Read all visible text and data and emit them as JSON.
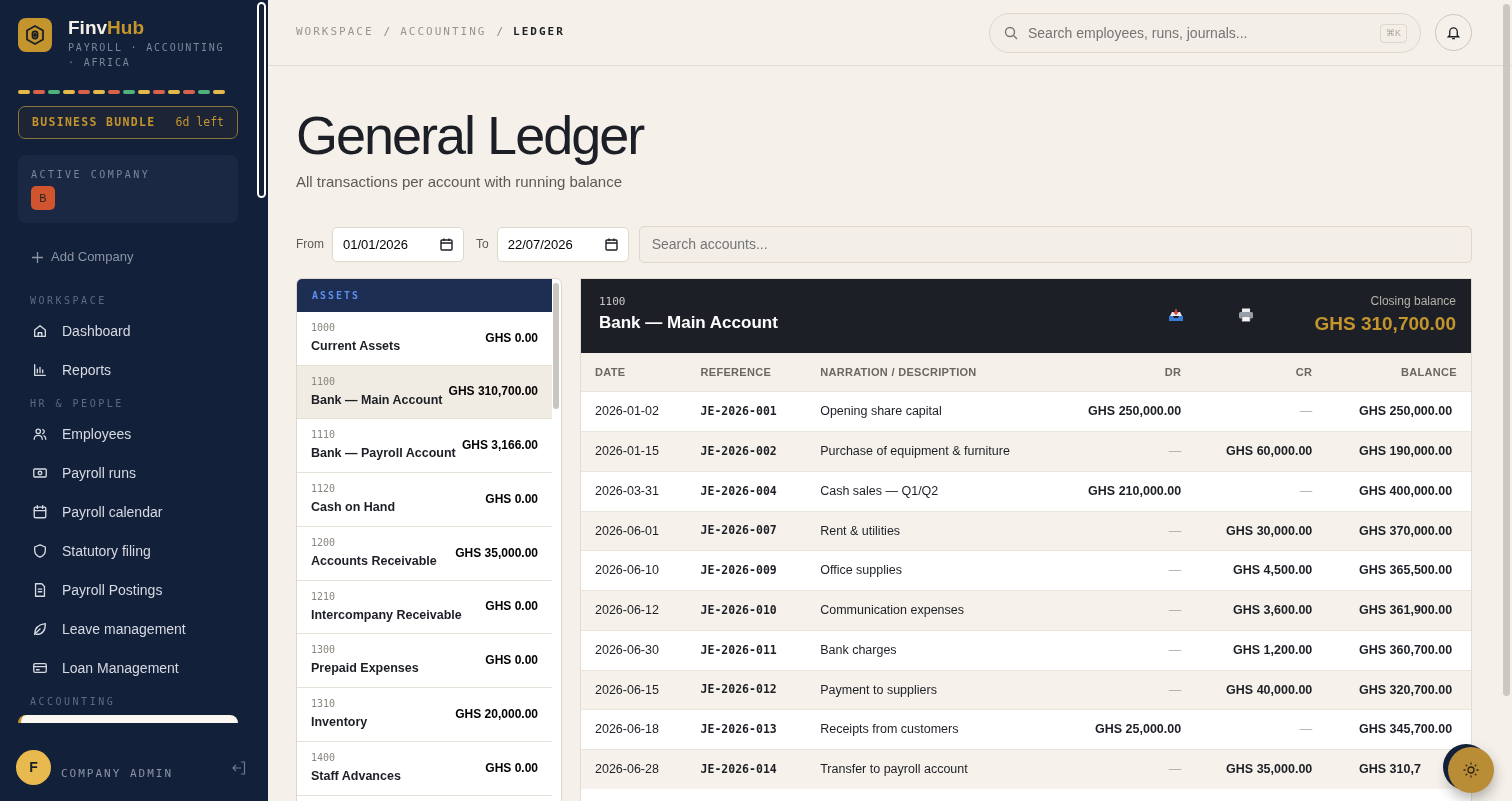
{
  "brand": {
    "name_a": "Finv",
    "name_b": "Hub",
    "tagline": "PAYROLL · ACCOUNTING · AFRICA"
  },
  "plan": {
    "name": "BUSINESS BUNDLE",
    "remaining": "6d left"
  },
  "active_company": {
    "label": "ACTIVE COMPANY",
    "initial": "B"
  },
  "add_company": "Add Company",
  "sidebar": [
    {
      "section": "WORKSPACE",
      "items": [
        {
          "label": "Dashboard"
        },
        {
          "label": "Reports"
        }
      ]
    },
    {
      "section": "HR & PEOPLE",
      "items": [
        {
          "label": "Employees"
        },
        {
          "label": "Payroll runs"
        },
        {
          "label": "Payroll calendar"
        },
        {
          "label": "Statutory filing"
        },
        {
          "label": "Payroll Postings"
        },
        {
          "label": "Leave management"
        },
        {
          "label": "Loan Management"
        }
      ]
    },
    {
      "section": "ACCOUNTING"
    }
  ],
  "user": {
    "initial": "F",
    "role": "COMPANY ADMIN"
  },
  "breadcrumb": [
    {
      "label": "WORKSPACE",
      "current": false
    },
    {
      "separator": "/",
      "label": "ACCOUNTING",
      "current": false
    },
    {
      "separator": "/",
      "label": "LEDGER",
      "current": true
    }
  ],
  "search": {
    "placeholder": "Search employees, runs, journals...",
    "shortcut": "⌘K"
  },
  "page": {
    "title": "General Ledger",
    "subtitle": "All transactions per account with running balance"
  },
  "filters": {
    "from_label": "From",
    "from": "01/01/2026",
    "to_label": "To",
    "to": "22/07/2026",
    "account_search_placeholder": "Search accounts..."
  },
  "accounts": {
    "group": "ASSETS",
    "items": [
      {
        "code": "1000",
        "name": "Current Assets",
        "amount": "GHS 0.00",
        "selected": false
      },
      {
        "code": "1100",
        "name": "Bank — Main Account",
        "amount": "GHS 310,700.00",
        "selected": true
      },
      {
        "code": "1110",
        "name": "Bank — Payroll Account",
        "amount": "GHS 3,166.00",
        "selected": false
      },
      {
        "code": "1120",
        "name": "Cash on Hand",
        "amount": "GHS 0.00",
        "selected": false
      },
      {
        "code": "1200",
        "name": "Accounts Receivable",
        "amount": "GHS 35,000.00",
        "selected": false
      },
      {
        "code": "1210",
        "name": "Intercompany Receivable",
        "amount": "GHS 0.00",
        "selected": false
      },
      {
        "code": "1300",
        "name": "Prepaid Expenses",
        "amount": "GHS 0.00",
        "selected": false
      },
      {
        "code": "1310",
        "name": "Inventory",
        "amount": "GHS 20,000.00",
        "selected": false
      },
      {
        "code": "1400",
        "name": "Staff Advances",
        "amount": "GHS 0.00",
        "selected": false
      }
    ]
  },
  "ledger": {
    "code": "1100",
    "name": "Bank — Main Account",
    "closing_label": "Closing balance",
    "closing": "GHS 310,700.00",
    "columns": [
      "DATE",
      "REFERENCE",
      "NARRATION / DESCRIPTION",
      "DR",
      "CR",
      "BALANCE"
    ],
    "rows": [
      [
        "2026-01-02",
        "JE-2026-001",
        "Opening share capital",
        "GHS 250,000.00",
        "—",
        "GHS 250,000.00"
      ],
      [
        "2026-01-15",
        "JE-2026-002",
        "Purchase of equipment & furniture",
        "—",
        "GHS 60,000.00",
        "GHS 190,000.00"
      ],
      [
        "2026-03-31",
        "JE-2026-004",
        "Cash sales — Q1/Q2",
        "GHS 210,000.00",
        "—",
        "GHS 400,000.00"
      ],
      [
        "2026-06-01",
        "JE-2026-007",
        "Rent & utilities",
        "—",
        "GHS 30,000.00",
        "GHS 370,000.00"
      ],
      [
        "2026-06-10",
        "JE-2026-009",
        "Office supplies",
        "—",
        "GHS 4,500.00",
        "GHS 365,500.00"
      ],
      [
        "2026-06-12",
        "JE-2026-010",
        "Communication expenses",
        "—",
        "GHS 3,600.00",
        "GHS 361,900.00"
      ],
      [
        "2026-06-30",
        "JE-2026-011",
        "Bank charges",
        "—",
        "GHS 1,200.00",
        "GHS 360,700.00"
      ],
      [
        "2026-06-15",
        "JE-2026-012",
        "Payment to suppliers",
        "—",
        "GHS 40,000.00",
        "GHS 320,700.00"
      ],
      [
        "2026-06-18",
        "JE-2026-013",
        "Receipts from customers",
        "GHS 25,000.00",
        "—",
        "GHS 345,700.00"
      ],
      [
        "2026-06-28",
        "JE-2026-014",
        "Transfer to payroll account",
        "—",
        "GHS 35,000.00",
        "GHS 310,7"
      ]
    ]
  }
}
